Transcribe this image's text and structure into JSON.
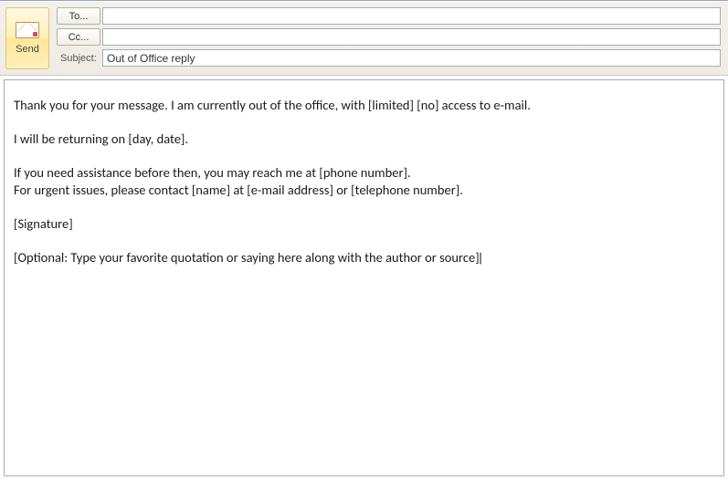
{
  "header": {
    "send_label": "Send",
    "to_label": "To...",
    "cc_label": "Cc...",
    "subject_label": "Subject:",
    "to_value": "",
    "cc_value": "",
    "subject_value": "Out of Office reply"
  },
  "body": {
    "line1": "Thank you for your message. I am currently out of the office, with [limited] [no] access to e-mail.",
    "line2": "",
    "line3": "I will be returning on [day, date].",
    "line4": "",
    "line5": "If you need assistance before then, you may reach me at [phone number].",
    "line6": "For urgent issues, please contact [name] at [e-mail address] or [telephone number].",
    "line7": "",
    "line8": "[Signature]",
    "line9": "",
    "line10": "[Optional: Type your favorite quotation or saying here along with the author or source]"
  }
}
